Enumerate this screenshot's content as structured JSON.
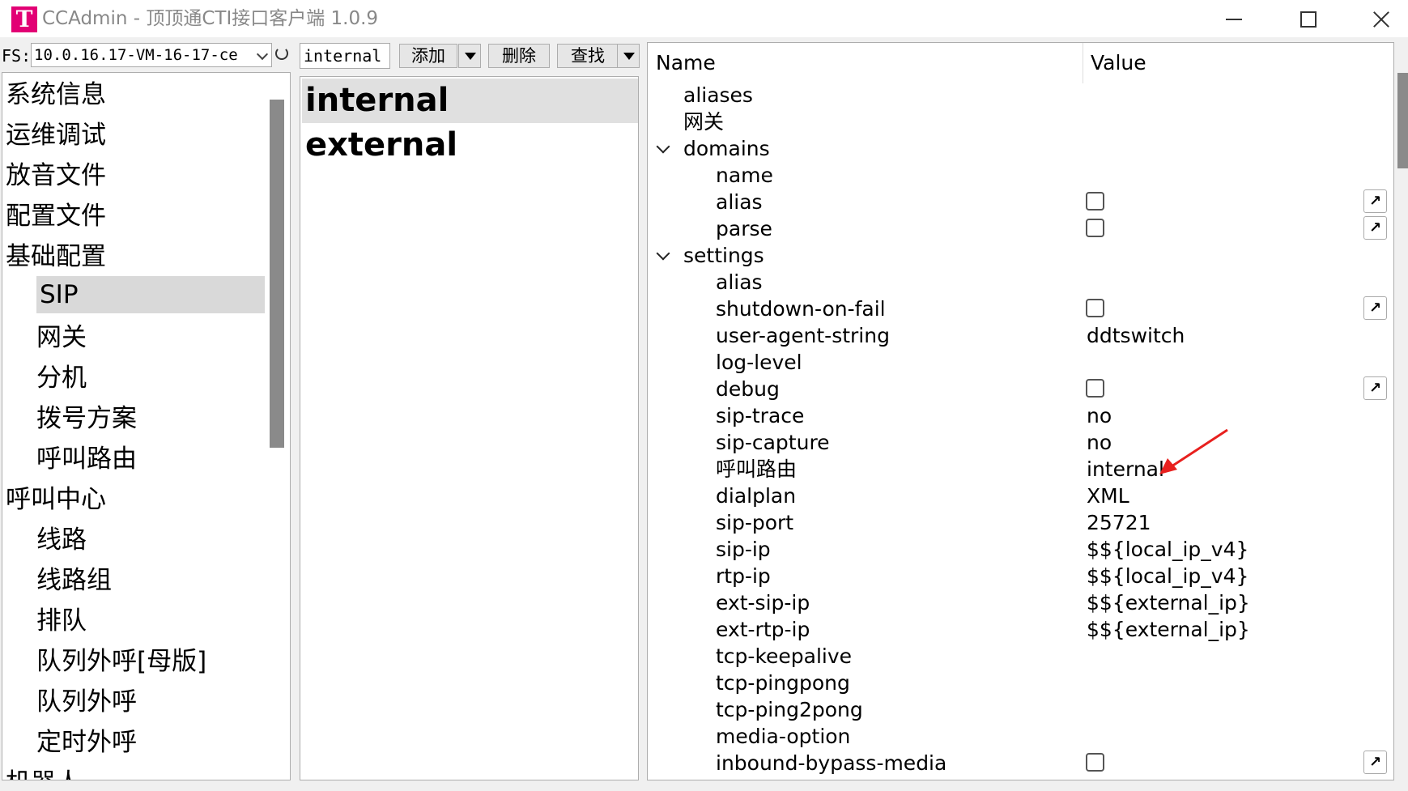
{
  "window": {
    "logo_letter": "T",
    "title": "CCAdmin - 顶顶通CTI接口客户端 1.0.9",
    "brand_color": "#e20074"
  },
  "toolbar": {
    "fs_label": "FS:",
    "fs_value": "10.0.16.17-VM-16-17-ce",
    "filter_value": "internal",
    "add_label": "添加",
    "delete_label": "删除",
    "find_label": "查找"
  },
  "nav": {
    "items": [
      {
        "label": "系统信息"
      },
      {
        "label": "运维调试"
      },
      {
        "label": "放音文件"
      },
      {
        "label": "配置文件"
      },
      {
        "label": "基础配置"
      },
      {
        "label": "SIP"
      },
      {
        "label": "网关"
      },
      {
        "label": "分机"
      },
      {
        "label": "拨号方案"
      },
      {
        "label": "呼叫路由"
      },
      {
        "label": "呼叫中心"
      },
      {
        "label": "线路"
      },
      {
        "label": "线路组"
      },
      {
        "label": "排队"
      },
      {
        "label": "队列外呼[母版]"
      },
      {
        "label": "队列外呼"
      },
      {
        "label": "定时外呼"
      },
      {
        "label": "机器人"
      }
    ],
    "selected": "SIP"
  },
  "profiles": {
    "items": [
      {
        "label": "internal"
      },
      {
        "label": "external"
      }
    ],
    "selected": "internal"
  },
  "grid": {
    "col_name": "Name",
    "col_value": "Value",
    "rows": [
      {
        "name": "aliases",
        "value": ""
      },
      {
        "name": "网关",
        "value": ""
      },
      {
        "name": "domains",
        "value": ""
      },
      {
        "name": "name",
        "value": ""
      },
      {
        "name": "alias",
        "value": ""
      },
      {
        "name": "parse",
        "value": ""
      },
      {
        "name": "settings",
        "value": ""
      },
      {
        "name": "alias",
        "value": ""
      },
      {
        "name": "shutdown-on-fail",
        "value": ""
      },
      {
        "name": "user-agent-string",
        "value": "ddtswitch"
      },
      {
        "name": "log-level",
        "value": ""
      },
      {
        "name": "debug",
        "value": ""
      },
      {
        "name": "sip-trace",
        "value": "no"
      },
      {
        "name": "sip-capture",
        "value": "no"
      },
      {
        "name": "呼叫路由",
        "value": "internal"
      },
      {
        "name": "dialplan",
        "value": "XML"
      },
      {
        "name": "sip-port",
        "value": "25721"
      },
      {
        "name": "sip-ip",
        "value": "$${local_ip_v4}"
      },
      {
        "name": "rtp-ip",
        "value": "$${local_ip_v4}"
      },
      {
        "name": "ext-sip-ip",
        "value": "$${external_ip}"
      },
      {
        "name": "ext-rtp-ip",
        "value": "$${external_ip}"
      },
      {
        "name": "tcp-keepalive",
        "value": ""
      },
      {
        "name": "tcp-pingpong",
        "value": ""
      },
      {
        "name": "tcp-ping2pong",
        "value": ""
      },
      {
        "name": "media-option",
        "value": ""
      },
      {
        "name": "inbound-bypass-media",
        "value": ""
      }
    ],
    "annotation_color": "#e8201e"
  }
}
